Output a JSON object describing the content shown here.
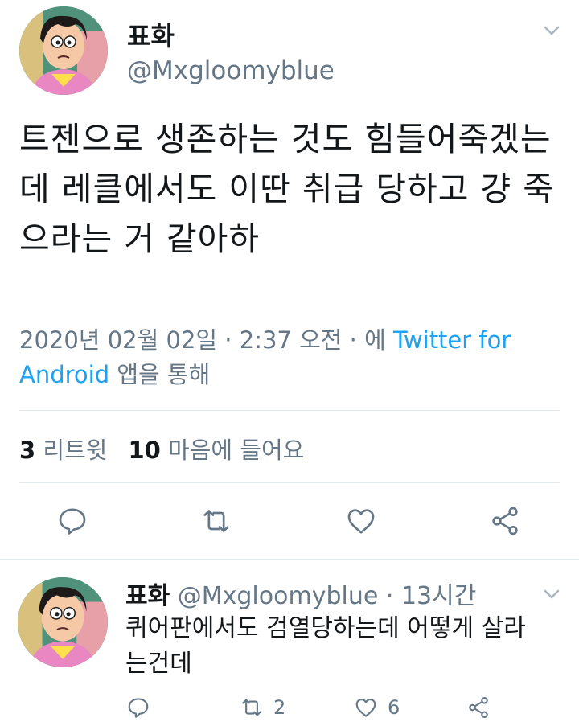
{
  "main_tweet": {
    "display_name": "표화",
    "handle": "@Mxgloomyblue",
    "text": "트젠으로 생존하는 것도 힘들어죽겠는데 레클에서도 이딴 취급 당하고 걍 죽으라는 거 같아하",
    "timestamp": "2020년 02월 02일 · 2:37 오전 · 에",
    "source_link": "Twitter for Android",
    "source_suffix": "앱을 통해",
    "retweet_count": "3",
    "retweet_label": "리트윗",
    "like_count": "10",
    "like_label": "마음에 들어요"
  },
  "reply_tweet": {
    "display_name": "표화",
    "handle": "@Mxgloomyblue",
    "separator": "·",
    "time_ago": "13시간",
    "text": "퀴어판에서도 검열당하는데 어떻게 살라는건데",
    "retweet_count": "2",
    "like_count": "6"
  },
  "icons": {
    "reply": "reply-icon",
    "retweet": "retweet-icon",
    "like": "heart-icon",
    "share": "share-icon",
    "chevron": "chevron-down-icon"
  },
  "colors": {
    "text": "#14171a",
    "secondary": "#657786",
    "link": "#1da1f2",
    "divider": "#e1e8ed"
  }
}
